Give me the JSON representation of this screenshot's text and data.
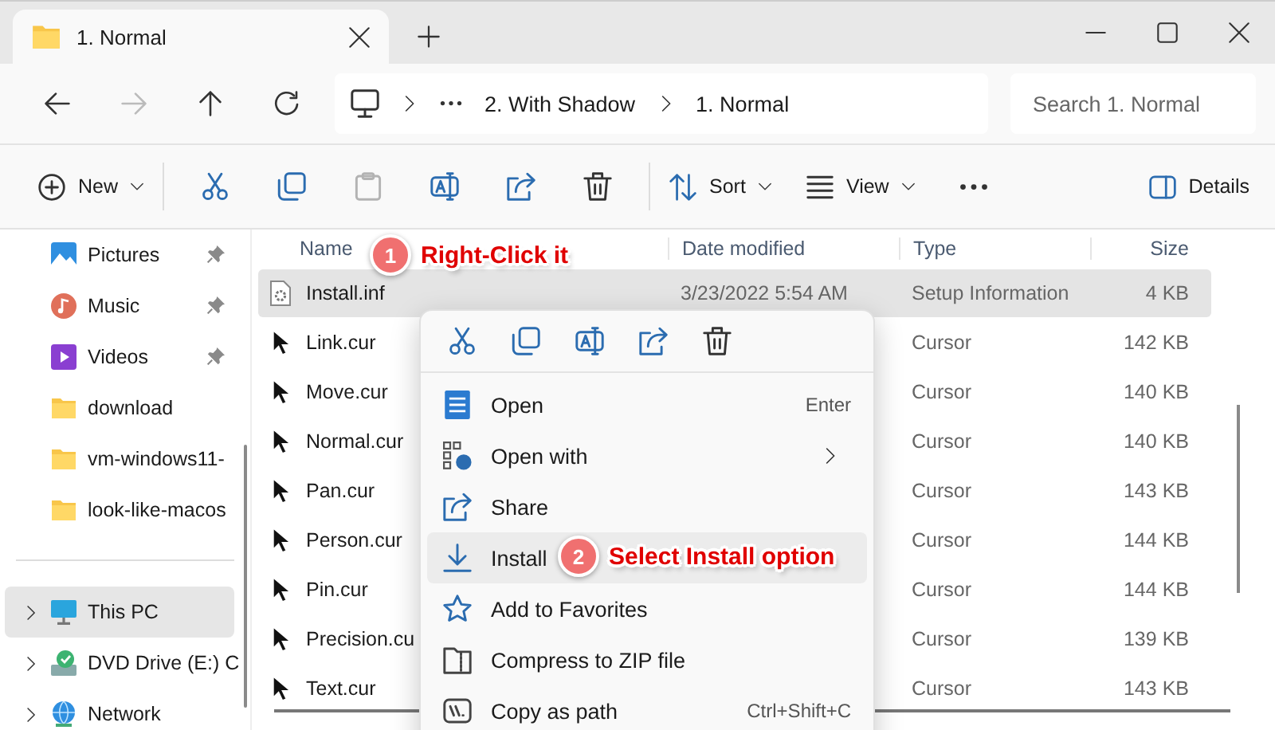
{
  "window": {
    "tab": {
      "title": "1. Normal",
      "selected": true
    }
  },
  "nav": {
    "breadcrumbs": [
      "2. With Shadow",
      "1. Normal"
    ],
    "search": {
      "placeholder": "Search 1. Normal"
    },
    "forward_disabled": true
  },
  "toolbar": {
    "new_label": "New",
    "tools": [
      {
        "disabled": false
      },
      {
        "disabled": false
      },
      {
        "disabled": true
      },
      {
        "disabled": false
      },
      {
        "disabled": false
      },
      {
        "disabled": false
      }
    ],
    "sort_label": "Sort",
    "view_label": "View",
    "details_label": "Details"
  },
  "sidebar": {
    "items": [
      {
        "label": "Pictures",
        "pinned": true,
        "expandable": false,
        "selected": false
      },
      {
        "label": "Music",
        "pinned": true,
        "expandable": false,
        "selected": false
      },
      {
        "label": "Videos",
        "pinned": true,
        "expandable": false,
        "selected": false
      },
      {
        "label": "download",
        "pinned": false,
        "expandable": false,
        "selected": false
      },
      {
        "label": "vm-windows11-",
        "pinned": false,
        "expandable": false,
        "selected": false
      },
      {
        "label": "look-like-macos",
        "pinned": false,
        "expandable": false,
        "selected": false
      },
      {
        "label": "This PC",
        "pinned": false,
        "expandable": true,
        "selected": true
      },
      {
        "label": "DVD Drive (E:) C",
        "pinned": false,
        "expandable": true,
        "selected": false
      },
      {
        "label": "Network",
        "pinned": false,
        "expandable": true,
        "selected": false
      }
    ]
  },
  "table": {
    "columns": [
      "Name",
      "Date modified",
      "Type",
      "Size"
    ],
    "rows": [
      {
        "name": "Install.inf",
        "date": "3/23/2022 5:54 AM",
        "type": "Setup Information",
        "size": "4 KB",
        "selected": true
      },
      {
        "name": "Link.cur",
        "type": "Cursor",
        "size": "142 KB",
        "selected": false
      },
      {
        "name": "Move.cur",
        "type": "Cursor",
        "size": "140 KB",
        "selected": false
      },
      {
        "name": "Normal.cur",
        "type": "Cursor",
        "size": "140 KB",
        "selected": false
      },
      {
        "name": "Pan.cur",
        "type": "Cursor",
        "size": "143 KB",
        "selected": false
      },
      {
        "name": "Person.cur",
        "type": "Cursor",
        "size": "144 KB",
        "selected": false
      },
      {
        "name": "Pin.cur",
        "type": "Cursor",
        "size": "144 KB",
        "selected": false
      },
      {
        "name": "Precision.cu",
        "type": "Cursor",
        "size": "139 KB",
        "selected": false
      },
      {
        "name": "Text.cur",
        "type": "Cursor",
        "size": "143 KB",
        "selected": false
      }
    ]
  },
  "context_menu": {
    "items": [
      {
        "label": "Open",
        "shortcut": "Enter",
        "selected": false
      },
      {
        "label": "Open with",
        "selected": false
      },
      {
        "label": "Share",
        "selected": false
      },
      {
        "label": "Install",
        "selected": true
      },
      {
        "label": "Add to Favorites",
        "selected": false
      },
      {
        "label": "Compress to ZIP file",
        "selected": false
      },
      {
        "label": "Copy as path",
        "shortcut": "Ctrl+Shift+C",
        "selected": false
      }
    ]
  },
  "annotations": [
    {
      "number": "1",
      "text": "Right-Click it"
    },
    {
      "number": "2",
      "text": "Select Install option"
    }
  ]
}
